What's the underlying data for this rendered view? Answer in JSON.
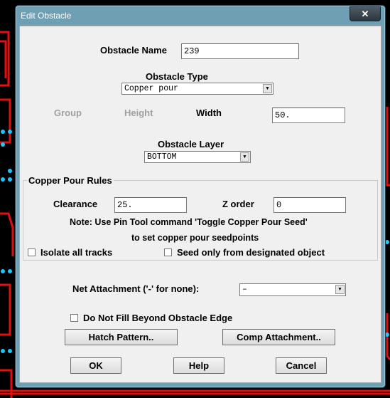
{
  "window": {
    "title": "Edit Obstacle",
    "close_glyph": "✕"
  },
  "obstacle_name": {
    "label": "Obstacle Name",
    "value": "239"
  },
  "obstacle_type": {
    "label": "Obstacle Type",
    "selected": "Copper pour"
  },
  "dims": {
    "group_label": "Group",
    "height_label": "Height",
    "width_label": "Width",
    "width_value": "50."
  },
  "obstacle_layer": {
    "label": "Obstacle Layer",
    "selected": "BOTTOM"
  },
  "copper_pour_rules": {
    "title": "Copper Pour Rules",
    "clearance_label": "Clearance",
    "clearance_value": "25.",
    "zorder_label": "Z order",
    "zorder_value": "0",
    "note_line1": "Note: Use Pin Tool command 'Toggle Copper Pour Seed'",
    "note_line2": "to set copper pour seedpoints",
    "isolate_label": "Isolate all tracks",
    "seed_label": "Seed only from designated object"
  },
  "net_attachment": {
    "label": "Net Attachment ('-' for none):",
    "selected": "–"
  },
  "do_not_fill_label": "Do Not Fill Beyond Obstacle Edge",
  "buttons": {
    "hatch": "Hatch Pattern..",
    "comp": "Comp Attachment..",
    "ok": "OK",
    "help": "Help",
    "cancel": "Cancel"
  },
  "colors": {
    "trace": "#e01010",
    "pad": "#18c8ff",
    "frame": "#6f9fb3"
  }
}
